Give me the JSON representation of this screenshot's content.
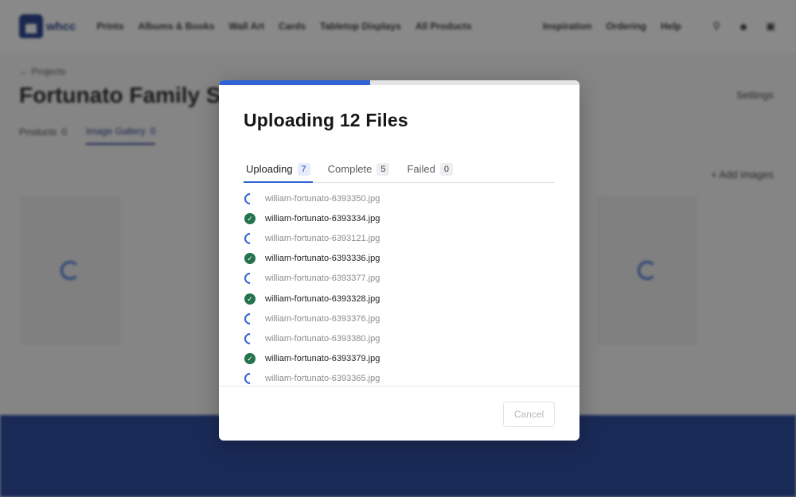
{
  "background": {
    "logo_text": "whcc",
    "nav": [
      "Prints",
      "Albums & Books",
      "Wall Art",
      "Cards",
      "Tabletop Displays",
      "All Products"
    ],
    "nav_right": [
      "Inspiration",
      "Ordering",
      "Help"
    ],
    "breadcrumb": "← Projects",
    "project_title": "Fortunato Family Se",
    "settings_label": "Settings",
    "tabs": [
      {
        "label": "Products",
        "count": "0"
      },
      {
        "label": "Image Gallery",
        "count": "0"
      }
    ],
    "add_images_label": "+ Add images"
  },
  "modal": {
    "title": "Uploading 12 Files",
    "progress": 0.42,
    "tabs": [
      {
        "label": "Uploading",
        "count": "7"
      },
      {
        "label": "Complete",
        "count": "5"
      },
      {
        "label": "Failed",
        "count": "0"
      }
    ],
    "files": [
      {
        "name": "william-fortunato-6393350.jpg",
        "status": "uploading"
      },
      {
        "name": "william-fortunato-6393334.jpg",
        "status": "complete"
      },
      {
        "name": "william-fortunato-6393121.jpg",
        "status": "uploading"
      },
      {
        "name": "william-fortunato-6393336.jpg",
        "status": "complete"
      },
      {
        "name": "william-fortunato-6393377.jpg",
        "status": "uploading"
      },
      {
        "name": "william-fortunato-6393328.jpg",
        "status": "complete"
      },
      {
        "name": "william-fortunato-6393376.jpg",
        "status": "uploading"
      },
      {
        "name": "william-fortunato-6393380.jpg",
        "status": "uploading"
      },
      {
        "name": "william-fortunato-6393379.jpg",
        "status": "complete"
      },
      {
        "name": "william-fortunato-6393365.jpg",
        "status": "uploading"
      }
    ],
    "cancel_label": "Cancel"
  },
  "colors": {
    "accent": "#3063d4",
    "success": "#24734d",
    "brand": "#1f3a8a"
  }
}
